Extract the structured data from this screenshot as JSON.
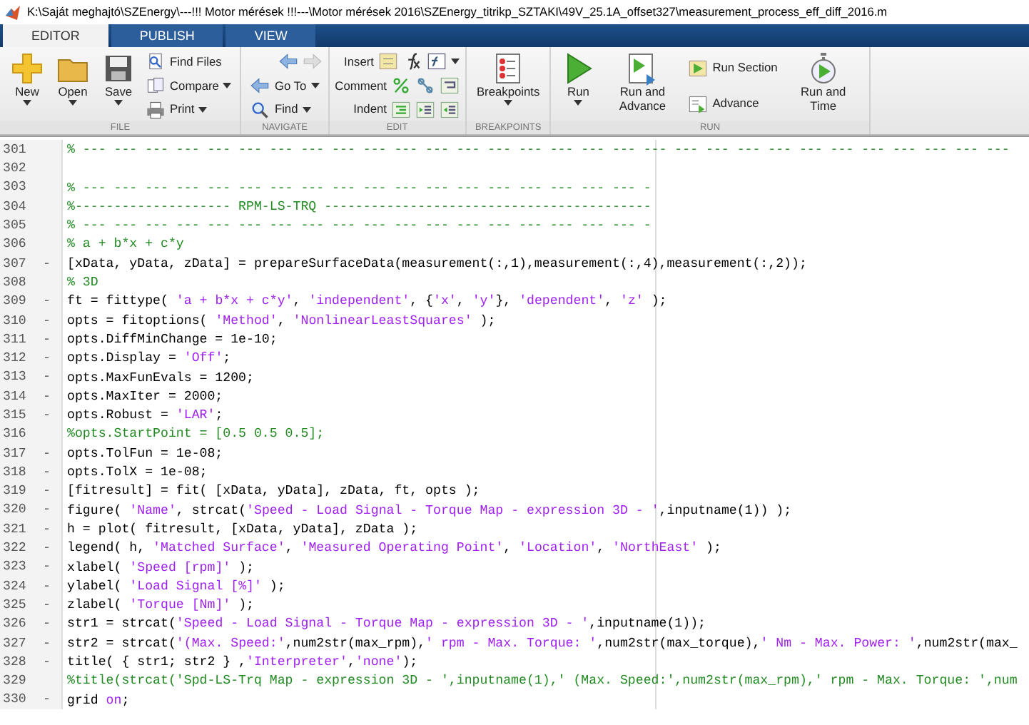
{
  "window": {
    "title": "K:\\Saját meghajtó\\SZEnergy\\---!!! Motor mérések !!!---\\Motor mérések 2016\\SZEnergy_titrikp_SZTAKI\\49V_25.1A_offset327\\measurement_process_eff_diff_2016.m"
  },
  "tabs": [
    {
      "label": "EDITOR",
      "selected": true
    },
    {
      "label": "PUBLISH",
      "selected": false
    },
    {
      "label": "VIEW",
      "selected": false
    }
  ],
  "ribbon": [
    {
      "label": "FILE",
      "items": [
        {
          "kind": "large",
          "label": "New",
          "dropdown": true
        },
        {
          "kind": "large",
          "label": "Open",
          "dropdown": true
        },
        {
          "kind": "large",
          "label": "Save",
          "dropdown": true
        },
        {
          "kind": "stack",
          "items": [
            {
              "kind": "small",
              "label": "Find Files",
              "dropdown": false
            },
            {
              "kind": "small",
              "label": "Compare",
              "dropdown": true
            },
            {
              "kind": "small",
              "label": "Print",
              "dropdown": true
            }
          ]
        }
      ]
    },
    {
      "label": "NAVIGATE",
      "items": [
        {
          "kind": "stack",
          "items": [
            {
              "kind": "icon_row",
              "dropdown": false
            },
            {
              "kind": "small",
              "label": "Go To",
              "dropdown": true
            },
            {
              "kind": "small",
              "label": "Find",
              "dropdown": true
            }
          ]
        }
      ]
    },
    {
      "label": "EDIT",
      "items": [
        {
          "kind": "stack",
          "items": [
            {
              "kind": "icon_row",
              "label": "Insert",
              "dropdown": true
            },
            {
              "kind": "icon_row",
              "label": "Comment",
              "dropdown": false
            },
            {
              "kind": "icon_row",
              "label": "Indent",
              "dropdown": false
            }
          ]
        }
      ]
    },
    {
      "label": "BREAKPOINTS",
      "items": [
        {
          "kind": "large",
          "label": "Breakpoints",
          "dropdown": true
        }
      ]
    },
    {
      "label": "RUN",
      "items": [
        {
          "kind": "large",
          "label": "Run",
          "dropdown": true
        },
        {
          "kind": "large",
          "label": "Run and Advance",
          "dropdown": false
        },
        {
          "kind": "stack",
          "items": [
            {
              "kind": "small",
              "label": "Run Section",
              "dropdown": false
            },
            {
              "kind": "small",
              "label": "Advance",
              "dropdown": false
            }
          ]
        },
        {
          "kind": "large",
          "label": "Run and Time",
          "dropdown": false
        }
      ]
    }
  ],
  "lines": [
    {
      "number": "301",
      "parts": [
        {
          "kind": "comment",
          "text": "% --- --- --- --- --- --- --- --- --- --- --- --- --- --- --- --- --- --- --- --- --- --- --- --- --- --- --- --- --- ---"
        }
      ]
    },
    {
      "number": "302"
    },
    {
      "number": "303",
      "parts": [
        {
          "kind": "comment",
          "text": "% --- --- --- --- --- --- --- --- --- --- --- --- --- --- --- --- --- --- -"
        }
      ]
    },
    {
      "number": "304",
      "parts": [
        {
          "kind": "comment",
          "text": "%-------------------- RPM-LS-TRQ ------------------------------------------"
        }
      ]
    },
    {
      "number": "305",
      "parts": [
        {
          "kind": "comment",
          "text": "% --- --- --- --- --- --- --- --- --- --- --- --- --- --- --- --- --- --- -"
        }
      ]
    },
    {
      "number": "306",
      "parts": [
        {
          "kind": "comment",
          "text": "% a + b*x + c*y"
        }
      ]
    },
    {
      "number": "307",
      "marker": "-",
      "parts": [
        {
          "kind": "code",
          "text": "[xData, yData, zData] = prepareSurfaceData(measurement(:,1),measurement(:,4),measurement(:,2));"
        }
      ]
    },
    {
      "number": "308",
      "parts": [
        {
          "kind": "comment",
          "text": "% 3D"
        }
      ]
    },
    {
      "number": "309",
      "marker": "-",
      "parts": [
        {
          "kind": "code",
          "text": "ft = fittype( "
        },
        {
          "kind": "string",
          "text": "'a + b*x + c*y'"
        },
        {
          "kind": "code",
          "text": ", "
        },
        {
          "kind": "string",
          "text": "'independent'"
        },
        {
          "kind": "code",
          "text": ", {"
        },
        {
          "kind": "string",
          "text": "'x'"
        },
        {
          "kind": "code",
          "text": ", "
        },
        {
          "kind": "string",
          "text": "'y'"
        },
        {
          "kind": "code",
          "text": "}, "
        },
        {
          "kind": "string",
          "text": "'dependent'"
        },
        {
          "kind": "code",
          "text": ", "
        },
        {
          "kind": "string",
          "text": "'z'"
        },
        {
          "kind": "code",
          "text": " );"
        }
      ]
    },
    {
      "number": "310",
      "marker": "-",
      "parts": [
        {
          "kind": "code",
          "text": "opts = fitoptions( "
        },
        {
          "kind": "string",
          "text": "'Method'"
        },
        {
          "kind": "code",
          "text": ", "
        },
        {
          "kind": "string",
          "text": "'NonlinearLeastSquares'"
        },
        {
          "kind": "code",
          "text": " );"
        }
      ]
    },
    {
      "number": "311",
      "marker": "-",
      "parts": [
        {
          "kind": "code",
          "text": "opts.DiffMinChange = 1e-10;"
        }
      ]
    },
    {
      "number": "312",
      "marker": "-",
      "parts": [
        {
          "kind": "code",
          "text": "opts.Display = "
        },
        {
          "kind": "string",
          "text": "'Off'"
        },
        {
          "kind": "code",
          "text": ";"
        }
      ]
    },
    {
      "number": "313",
      "marker": "-",
      "parts": [
        {
          "kind": "code",
          "text": "opts.MaxFunEvals = 1200;"
        }
      ]
    },
    {
      "number": "314",
      "marker": "-",
      "parts": [
        {
          "kind": "code",
          "text": "opts.MaxIter = 2000;"
        }
      ]
    },
    {
      "number": "315",
      "marker": "-",
      "parts": [
        {
          "kind": "code",
          "text": "opts.Robust = "
        },
        {
          "kind": "string",
          "text": "'LAR'"
        },
        {
          "kind": "code",
          "text": ";"
        }
      ]
    },
    {
      "number": "316",
      "parts": [
        {
          "kind": "comment",
          "text": "%opts.StartPoint = [0.5 0.5 0.5];"
        }
      ]
    },
    {
      "number": "317",
      "marker": "-",
      "parts": [
        {
          "kind": "code",
          "text": "opts.TolFun = 1e-08;"
        }
      ]
    },
    {
      "number": "318",
      "marker": "-",
      "parts": [
        {
          "kind": "code",
          "text": "opts.TolX = 1e-08;"
        }
      ]
    },
    {
      "number": "319",
      "marker": "-",
      "parts": [
        {
          "kind": "code",
          "text": "[fitresult] = fit( [xData, yData], zData, ft, opts );"
        }
      ]
    },
    {
      "number": "320",
      "marker": "-",
      "parts": [
        {
          "kind": "code",
          "text": "figure( "
        },
        {
          "kind": "string",
          "text": "'Name'"
        },
        {
          "kind": "code",
          "text": ", strcat("
        },
        {
          "kind": "string",
          "text": "'Speed - Load Signal - Torque Map - expression 3D - '"
        },
        {
          "kind": "code",
          "text": ",inputname(1)) );"
        }
      ]
    },
    {
      "number": "321",
      "marker": "-",
      "parts": [
        {
          "kind": "code",
          "text": "h = plot( fitresult, [xData, yData], zData );"
        }
      ]
    },
    {
      "number": "322",
      "marker": "-",
      "parts": [
        {
          "kind": "code",
          "text": "legend( h, "
        },
        {
          "kind": "string",
          "text": "'Matched Surface'"
        },
        {
          "kind": "code",
          "text": ", "
        },
        {
          "kind": "string",
          "text": "'Measured Operating Point'"
        },
        {
          "kind": "code",
          "text": ", "
        },
        {
          "kind": "string",
          "text": "'Location'"
        },
        {
          "kind": "code",
          "text": ", "
        },
        {
          "kind": "string",
          "text": "'NorthEast'"
        },
        {
          "kind": "code",
          "text": " );"
        }
      ]
    },
    {
      "number": "323",
      "marker": "-",
      "parts": [
        {
          "kind": "code",
          "text": "xlabel( "
        },
        {
          "kind": "string",
          "text": "'Speed [rpm]'"
        },
        {
          "kind": "code",
          "text": " );"
        }
      ]
    },
    {
      "number": "324",
      "marker": "-",
      "parts": [
        {
          "kind": "code",
          "text": "ylabel( "
        },
        {
          "kind": "string",
          "text": "'Load Signal [%]'"
        },
        {
          "kind": "code",
          "text": " );"
        }
      ]
    },
    {
      "number": "325",
      "marker": "-",
      "parts": [
        {
          "kind": "code",
          "text": "zlabel( "
        },
        {
          "kind": "string",
          "text": "'Torque [Nm]'"
        },
        {
          "kind": "code",
          "text": " );"
        }
      ]
    },
    {
      "number": "326",
      "marker": "-",
      "parts": [
        {
          "kind": "code",
          "text": "str1 = strcat("
        },
        {
          "kind": "string",
          "text": "'Speed - Load Signal - Torque Map - expression 3D - '"
        },
        {
          "kind": "code",
          "text": ",inputname(1));"
        }
      ]
    },
    {
      "number": "327",
      "marker": "-",
      "parts": [
        {
          "kind": "code",
          "text": "str2 = strcat("
        },
        {
          "kind": "string",
          "text": "'(Max. Speed:'"
        },
        {
          "kind": "code",
          "text": ",num2str(max_rpm),"
        },
        {
          "kind": "string",
          "text": "' rpm - Max. Torque: '"
        },
        {
          "kind": "code",
          "text": ",num2str(max_torque),"
        },
        {
          "kind": "string",
          "text": "' Nm - Max. Power: '"
        },
        {
          "kind": "code",
          "text": ",num2str(max_"
        }
      ]
    },
    {
      "number": "328",
      "marker": "-",
      "parts": [
        {
          "kind": "code",
          "text": "title( { str1; str2 } ,"
        },
        {
          "kind": "string",
          "text": "'Interpreter'"
        },
        {
          "kind": "code",
          "text": ","
        },
        {
          "kind": "string",
          "text": "'none'"
        },
        {
          "kind": "code",
          "text": ");"
        }
      ]
    },
    {
      "number": "329",
      "parts": [
        {
          "kind": "comment",
          "text": "%title(strcat('Spd-LS-Trq Map - expression 3D - ',inputname(1),' (Max. Speed:',num2str(max_rpm),' rpm - Max. Torque: ',num"
        }
      ]
    },
    {
      "number": "330",
      "marker": "-",
      "parts": [
        {
          "kind": "code",
          "text": "grid "
        },
        {
          "kind": "string",
          "text": "on"
        },
        {
          "kind": "code",
          "text": ";"
        }
      ]
    }
  ]
}
